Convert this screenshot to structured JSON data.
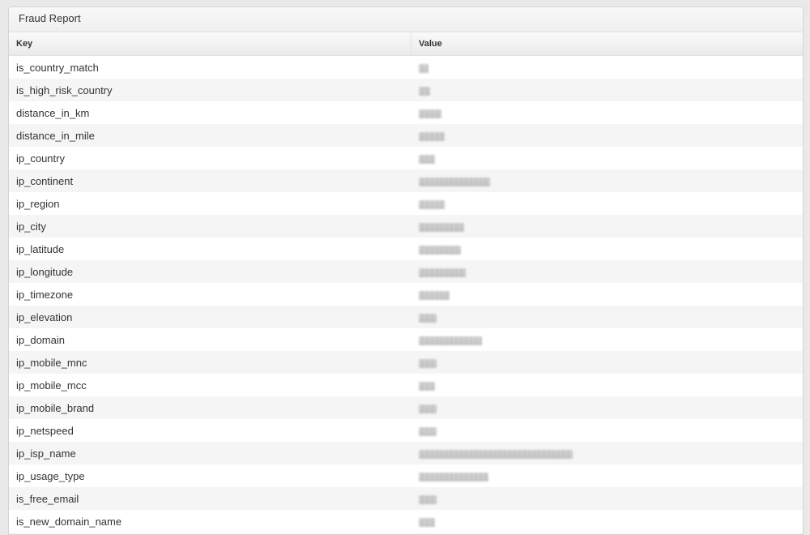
{
  "panel": {
    "title": "Fraud Report"
  },
  "table": {
    "headers": {
      "key": "Key",
      "value": "Value"
    },
    "rows": [
      {
        "key": "is_country_match",
        "value_redacted": true,
        "redacted_width": 12
      },
      {
        "key": "is_high_risk_country",
        "value_redacted": true,
        "redacted_width": 14
      },
      {
        "key": "distance_in_km",
        "value_redacted": true,
        "redacted_width": 28
      },
      {
        "key": "distance_in_mile",
        "value_redacted": true,
        "redacted_width": 32
      },
      {
        "key": "ip_country",
        "value_redacted": true,
        "redacted_width": 20
      },
      {
        "key": "ip_continent",
        "value_redacted": true,
        "redacted_width": 88
      },
      {
        "key": "ip_region",
        "value_redacted": true,
        "redacted_width": 32
      },
      {
        "key": "ip_city",
        "value_redacted": true,
        "redacted_width": 56
      },
      {
        "key": "ip_latitude",
        "value_redacted": true,
        "redacted_width": 52
      },
      {
        "key": "ip_longitude",
        "value_redacted": true,
        "redacted_width": 58
      },
      {
        "key": "ip_timezone",
        "value_redacted": true,
        "redacted_width": 38
      },
      {
        "key": "ip_elevation",
        "value_redacted": true,
        "redacted_width": 22
      },
      {
        "key": "ip_domain",
        "value_redacted": true,
        "redacted_width": 78
      },
      {
        "key": "ip_mobile_mnc",
        "value_redacted": true,
        "redacted_width": 22
      },
      {
        "key": "ip_mobile_mcc",
        "value_redacted": true,
        "redacted_width": 20
      },
      {
        "key": "ip_mobile_brand",
        "value_redacted": true,
        "redacted_width": 22
      },
      {
        "key": "ip_netspeed",
        "value_redacted": true,
        "redacted_width": 22
      },
      {
        "key": "ip_isp_name",
        "value_redacted": true,
        "redacted_width": 190
      },
      {
        "key": "ip_usage_type",
        "value_redacted": true,
        "redacted_width": 86
      },
      {
        "key": "is_free_email",
        "value_redacted": true,
        "redacted_width": 22
      },
      {
        "key": "is_new_domain_name",
        "value_redacted": true,
        "redacted_width": 20
      }
    ]
  }
}
